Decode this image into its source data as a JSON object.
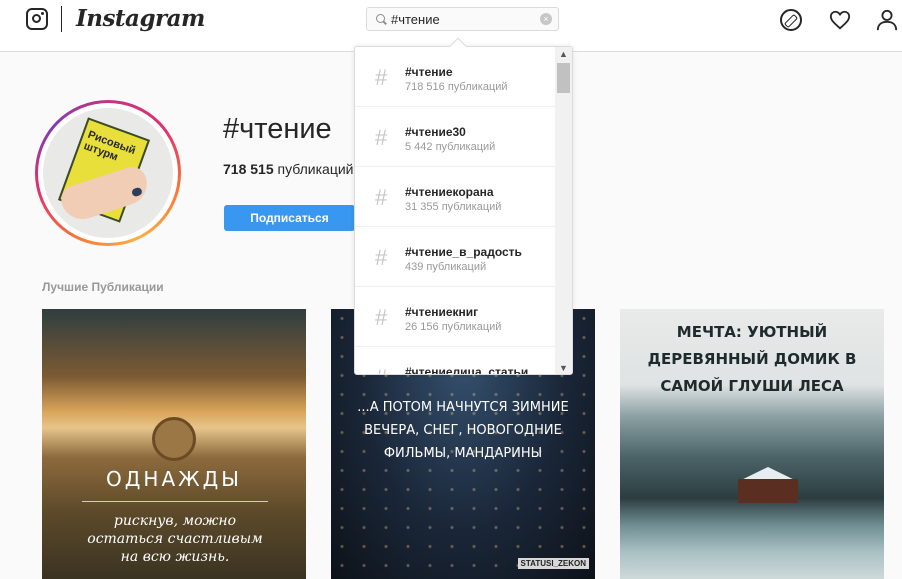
{
  "header": {
    "logo_text": "Instagram",
    "search": {
      "value": "#чтение",
      "clear": "×"
    },
    "icons": [
      "camera-icon",
      "compass-icon",
      "heart-icon",
      "person-icon"
    ]
  },
  "profile": {
    "hashtag": "#чтение",
    "posts_count": "718 515",
    "posts_label": "публикаций",
    "follow_label": "Подписаться",
    "avatar_book_title": "Рисовый штурм"
  },
  "section_label": "Лучшие Публикации",
  "posts": [
    {
      "line1": "ОДНАЖДЫ",
      "line2": "рискнув, можно остаться счастливым на всю жизнь."
    },
    {
      "text": "...А ПОТОМ НАЧНУТСЯ ЗИМНИЕ ВЕЧЕРА, СНЕГ, НОВОГОДНИЕ ФИЛЬМЫ, МАНДАРИНЫ",
      "stamp": "STATUSI_ZEKON"
    },
    {
      "text": "МЕЧТА: УЮТНЫЙ ДЕРЕВЯННЫЙ ДОМИК В САМОЙ ГЛУШИ ЛЕСА"
    }
  ],
  "dropdown": {
    "items": [
      {
        "name": "#чтение",
        "count": "718 516 публикаций"
      },
      {
        "name": "#чтение30",
        "count": "5 442 публикаций"
      },
      {
        "name": "#чтениекорана",
        "count": "31 355 публикаций"
      },
      {
        "name": "#чтение_в_радость",
        "count": "439 публикаций"
      },
      {
        "name": "#чтениекниг",
        "count": "26 156 публикаций"
      },
      {
        "name": "#чтениелица_статьи",
        "count": ""
      }
    ],
    "hash_symbol": "#"
  },
  "colors": {
    "accent": "#3897f0",
    "ring_start": "#c13584",
    "ring_end": "#fcaf45"
  }
}
